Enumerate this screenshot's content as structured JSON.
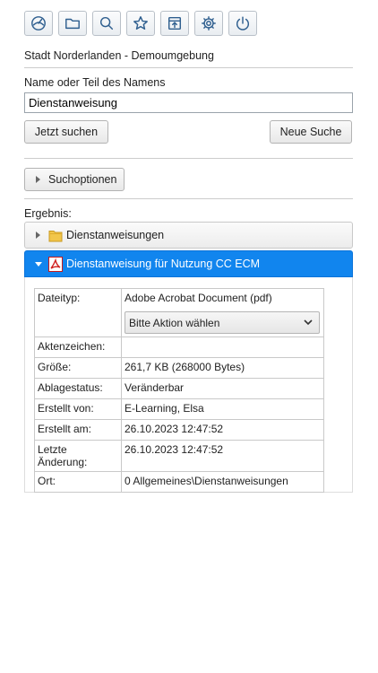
{
  "toolbar": {
    "icons": [
      "dashboard-icon",
      "folder-icon",
      "search-icon",
      "star-icon",
      "export-icon",
      "gear-icon",
      "power-icon"
    ]
  },
  "header": {
    "organization": "Stadt Norderlanden - Demoumgebung"
  },
  "search": {
    "name_label": "Name oder Teil des Namens",
    "query_value": "Dienstanweisung",
    "search_button": "Jetzt suchen",
    "new_search_button": "Neue Suche",
    "options_label": "Suchoptionen"
  },
  "results": {
    "label": "Ergebnis:",
    "items": [
      {
        "label": "Dienstanweisungen",
        "type": "folder",
        "expanded": false
      },
      {
        "label": "Dienstanweisung für Nutzung CC ECM",
        "type": "pdf",
        "expanded": true,
        "selected": true
      }
    ]
  },
  "details": {
    "filetype_key": "Dateityp:",
    "filetype_value": "Adobe Acrobat Document (pdf)",
    "action_select": "Bitte Aktion wählen",
    "rows": [
      {
        "key": "Aktenzeichen:",
        "value": ""
      },
      {
        "key": "Größe:",
        "value": "261,7 KB (268000 Bytes)"
      },
      {
        "key": "Ablagestatus:",
        "value": "Veränderbar"
      },
      {
        "key": "Erstellt von:",
        "value": "E-Learning, Elsa"
      },
      {
        "key": "Erstellt am:",
        "value": "26.10.2023 12:47:52"
      },
      {
        "key": "Letzte Änderung:",
        "value": "26.10.2023 12:47:52"
      },
      {
        "key": "Ort:",
        "value": "0 Allgemeines\\Dienstanweisungen"
      }
    ]
  },
  "colors": {
    "accent": "#1185ee",
    "icon": "#2f5f8f"
  }
}
